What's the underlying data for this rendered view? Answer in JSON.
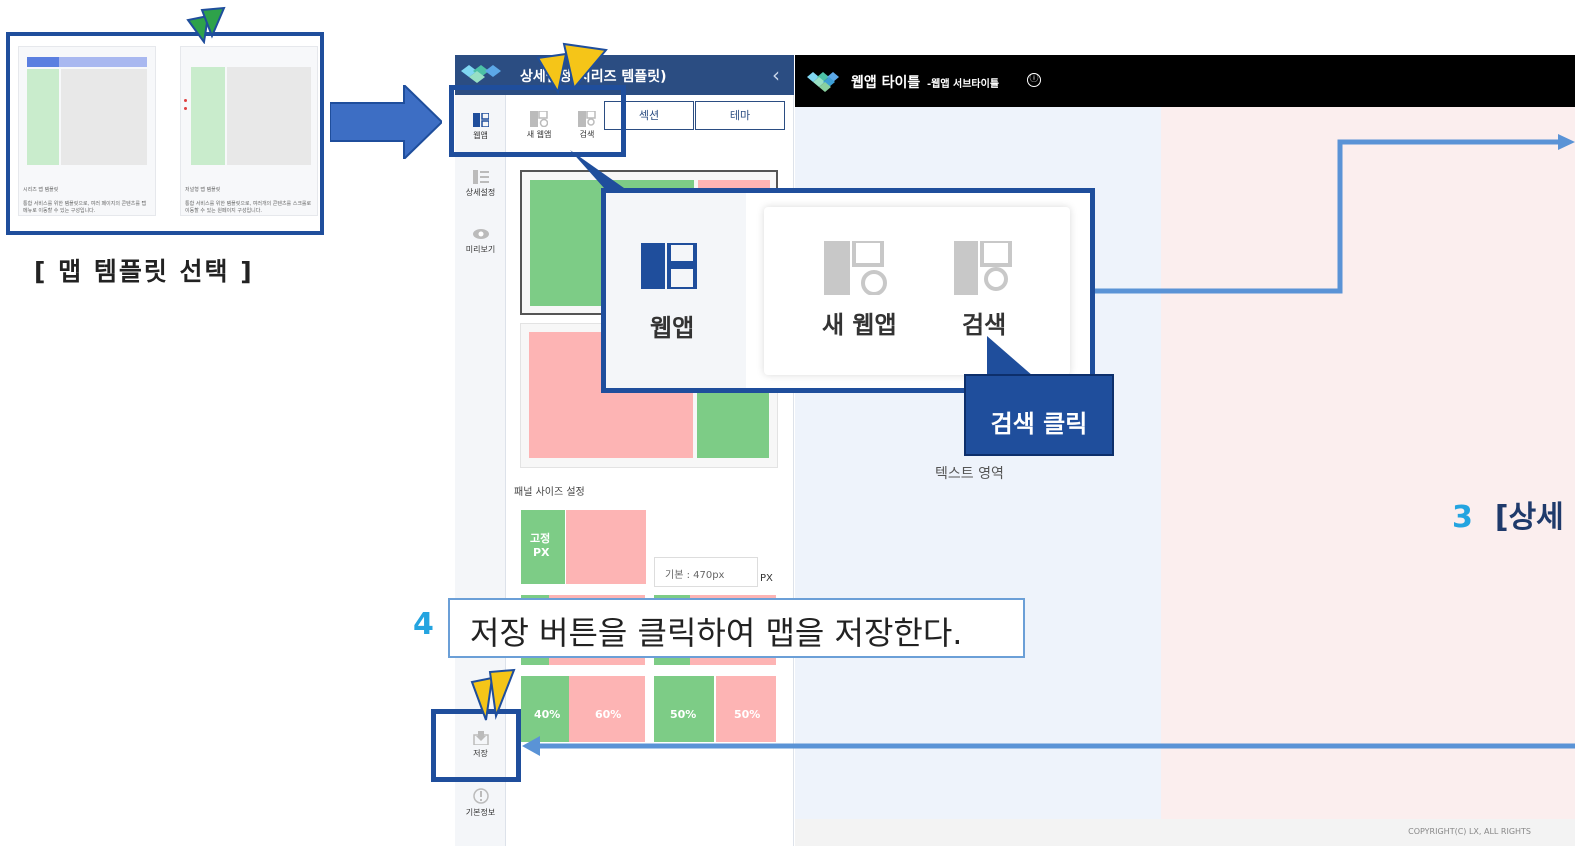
{
  "template_select": {
    "title": "[ 맵 템플릿 선택 ]",
    "card1_caption": "시리즈 맵 템플릿",
    "card1_desc": "통합 서비스를 위한 템플릿으로, 여러 페이지의 콘텐츠를 탭 메뉴로 이동할 수 있는 구성입니다.",
    "card2_caption": "저널형 맵 템플릿",
    "card2_desc": "통합 서비스를 위한 템플릿으로, 여러개의 콘텐츠를 스크롤로 이동할 수 있는 원페이지 구성입니다."
  },
  "rail": {
    "items": [
      {
        "label": "웹앱",
        "icon": "webapp-icon"
      },
      {
        "label": "상세설정",
        "icon": "settings-icon"
      },
      {
        "label": "미리보기",
        "icon": "eye-icon"
      },
      {
        "label": "저장",
        "icon": "save-icon"
      },
      {
        "label": "기본정보",
        "icon": "info-icon"
      }
    ]
  },
  "panel": {
    "title": "상세설정(시리즈 템플릿)",
    "sub_tabs": [
      "새 웹앱",
      "검색"
    ],
    "tabs": [
      "섹션",
      "테마"
    ],
    "size_section_label": "패널 사이즈 설정",
    "fixed_label_1": "고정",
    "fixed_label_2": "PX",
    "px_input_placeholder": "기본 : 470px",
    "px_unit": "PX",
    "ratio_rows": [
      {
        "left": "40%",
        "right": "60%"
      },
      {
        "left": "50%",
        "right": "50%"
      }
    ]
  },
  "app": {
    "title": "웹앱 타이틀",
    "subtitle": "-웹앱 서브타이틀",
    "info_icon": "ⓘ",
    "text_area_label": "텍스트 영역",
    "copyright": "COPYRIGHT(C) LX, ALL RIGHTS"
  },
  "callouts": {
    "zoom_labels": {
      "webapp": "웹앱",
      "new_webapp": "새 웹앱",
      "search": "검색"
    },
    "click_tag": "검색 클릭",
    "step4_num": "4",
    "step4_text": "저장 버튼을 클릭하여 맵을 저장한다.",
    "step3_num": "3",
    "step3_text": "[상세"
  },
  "colors": {
    "brand_blue": "#2b4d82",
    "callout_blue": "#1f4e9c",
    "step_cyan": "#24a4e0",
    "panel_green": "#7dcc86",
    "panel_pink": "#fdb4b4",
    "pointer_yellow": "#f5c518"
  }
}
